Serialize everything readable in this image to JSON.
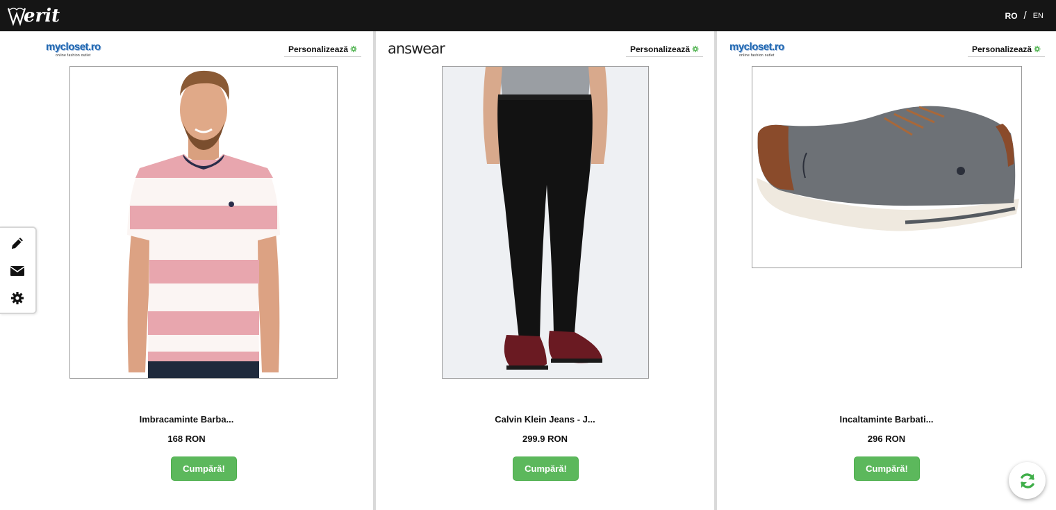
{
  "header": {
    "logo_text": "erit",
    "lang_ro": "RO",
    "lang_sep": "/",
    "lang_en": "EN"
  },
  "colors": {
    "topbar": "#151515",
    "buy_button": "#5cb85c",
    "gear_accent": "#5cb85c",
    "divider": "#d9d9d9"
  },
  "products": [
    {
      "store_logo_text": "mycloset.ro",
      "store_logo_sub": "online fashion outlet",
      "personalize_label": "Personalizează",
      "image": "striped pink and white t-shirt on model",
      "name": "Imbracaminte Barba...",
      "price": "168 RON",
      "buy_label": "Cumpără!"
    },
    {
      "store_logo_text": "answear",
      "personalize_label": "Personalizează",
      "image": "black skinny jeans with burgundy shoes",
      "name": "Calvin Klein Jeans - J...",
      "price": "299.9 RON",
      "buy_label": "Cumpără!"
    },
    {
      "store_logo_text": "mycloset.ro",
      "store_logo_sub": "online fashion outlet",
      "personalize_label": "Personalizează",
      "image": "grey canvas sneaker with brown leather details",
      "name": "Incaltaminte Barbati...",
      "price": "296 RON",
      "buy_label": "Cumpără!"
    }
  ],
  "sidebar": {
    "icons": [
      "pencil-icon",
      "envelope-icon",
      "gear-icon"
    ]
  },
  "fab": {
    "icon": "refresh-icon"
  }
}
